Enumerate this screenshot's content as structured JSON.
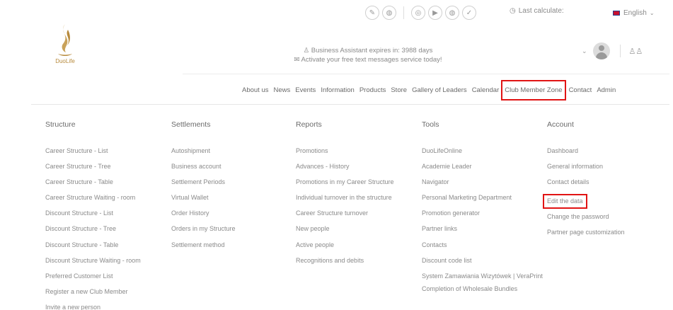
{
  "topbar": {
    "social_icons": [
      "compass-icon",
      "messenger-icon",
      "instagram-icon",
      "youtube-icon",
      "messenger-icon",
      "twitter-icon"
    ],
    "last_calculate_label": "Last calculate:",
    "language_label": "English"
  },
  "logo": {
    "text": "DuoLife"
  },
  "business": {
    "expires_text": "Business Assistant expires in: 3988 days",
    "sms_text": "Activate your free text messages service today!"
  },
  "nav": {
    "items": [
      "About us",
      "News",
      "Events",
      "Information",
      "Products",
      "Store",
      "Gallery of Leaders",
      "Calendar",
      "Club Member Zone",
      "Contact",
      "Admin"
    ]
  },
  "menu": {
    "structure": {
      "title": "Structure",
      "links": [
        "Career Structure - List",
        "Career Structure - Tree",
        "Career Structure - Table",
        "Career Structure Waiting - room",
        "Discount Structure - List",
        "Discount Structure - Tree",
        "Discount Structure - Table",
        "Discount Structure Waiting - room",
        "Preferred Customer List",
        "Register a new Club Member",
        "Invite a new person"
      ]
    },
    "settlements": {
      "title": "Settlements",
      "links": [
        "Autoshipment",
        "Business account",
        "Settlement Periods",
        "Virtual Wallet",
        "Order History",
        "Orders in my Structure",
        "Settlement method"
      ]
    },
    "reports": {
      "title": "Reports",
      "links": [
        "Promotions",
        "Advances - History",
        "Promotions in my Career Structure",
        "Individual turnover in the structure",
        "Career Structure turnover",
        "New people",
        "Active people",
        "Recognitions and debits"
      ]
    },
    "tools": {
      "title": "Tools",
      "links": [
        "DuoLifeOnline",
        "Academie Leader",
        "Navigator",
        "Personal Marketing Department",
        "Promotion generator",
        "Partner links",
        "Contacts",
        "Discount code list",
        "System Zamawiania Wizytówek | VeraPrint",
        "Completion of Wholesale Bundles"
      ]
    },
    "account": {
      "title": "Account",
      "links": [
        "Dashboard",
        "General information",
        "Contact details",
        "Edit the data",
        "Change the password",
        "Partner page customization"
      ]
    }
  },
  "colors": {
    "highlight": "#e11414",
    "brand": "#b78a3c"
  }
}
